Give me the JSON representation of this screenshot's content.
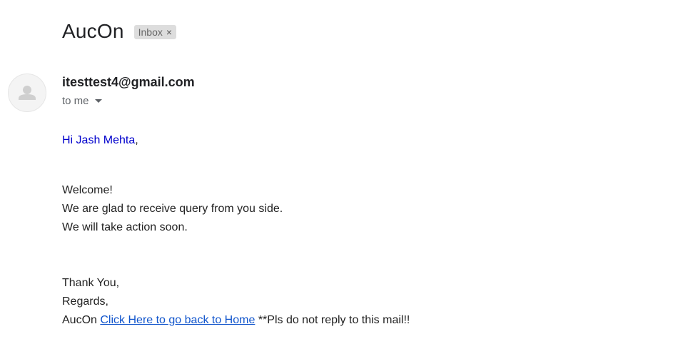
{
  "email": {
    "subject": "AucOn",
    "label": {
      "text": "Inbox",
      "remove_glyph": "×"
    },
    "sender": "itesttest4@gmail.com",
    "recipient_text": "to me",
    "avatar_icon": "person-icon"
  },
  "body": {
    "greeting_name": "Hi Jash Mehta",
    "greeting_punct": ",",
    "lines": [
      "Welcome!",
      "We are glad to receive query from you side.",
      "We will take action soon."
    ],
    "closing_1": "Thank You,",
    "closing_2": "Regards,",
    "signature_name": "AucOn",
    "home_link": "Click Here to go back to Home",
    "footer_note": "**Pls do not reply to this mail!!"
  },
  "colors": {
    "greeting": "#0000cc",
    "link": "#1155cc",
    "chip_bg": "#dddddd"
  }
}
